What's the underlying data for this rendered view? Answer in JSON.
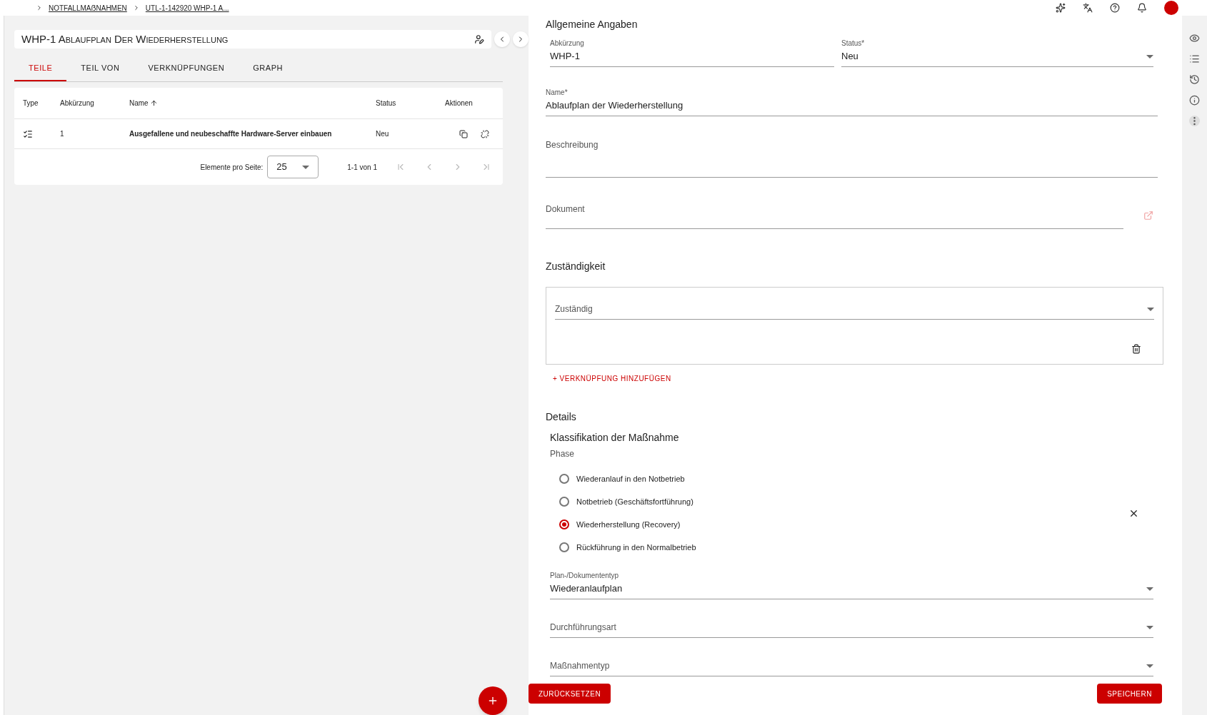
{
  "breadcrumb": [
    "NOTFALLMAẞNAHMEN",
    "UTL-1-142920 WHP-1 A..."
  ],
  "left": {
    "title": "WHP-1 Ablaufplan Der Wiederherstellung",
    "tabs": [
      {
        "label": "TEILE",
        "selected": true
      },
      {
        "label": "TEIL VON",
        "selected": false
      },
      {
        "label": "VERKNÜPFUNGEN",
        "selected": false
      },
      {
        "label": "GRAPH",
        "selected": false
      }
    ],
    "table": {
      "columns": [
        {
          "label": "Type",
          "sorted": false
        },
        {
          "label": "Abkürzung",
          "sorted": false
        },
        {
          "label": "Name",
          "sorted": true
        },
        {
          "label": "Status",
          "sorted": false
        },
        {
          "label": "Aktionen",
          "sorted": false
        }
      ],
      "rows": [
        {
          "abbreviation": "1",
          "name": "Ausgefallene und neubeschaffte Hardware-Server einbauen",
          "status": "Neu"
        }
      ]
    },
    "pagination": {
      "label": "Elemente pro Seite:",
      "page_size": "25",
      "range": "1-1 von 1"
    }
  },
  "form": {
    "general_title": "Allgemeine Angaben",
    "abbreviation": {
      "label": "Abkürzung",
      "value": "WHP-1"
    },
    "status": {
      "label": "Status*",
      "value": "Neu"
    },
    "name": {
      "label": "Name*",
      "value": "Ablaufplan der Wiederherstellung"
    },
    "description": {
      "label": "Beschreibung"
    },
    "document": {
      "label": "Dokument"
    },
    "responsibility_title": "Zuständigkeit",
    "responsible": {
      "label": "Zuständig"
    },
    "add_link": "+ VERKNÜPFUNG HINZUFÜGEN",
    "details_title": "Details",
    "classification_title": "Klassifikation der Maßnahme",
    "phase_label": "Phase",
    "phases": [
      {
        "label": "Wiederanlauf in den Notbetrieb",
        "selected": false
      },
      {
        "label": "Notbetrieb (Geschäftsfortführung)",
        "selected": false
      },
      {
        "label": "Wiederherstellung (Recovery)",
        "selected": true
      },
      {
        "label": "Rückführung in den Normalbetrieb",
        "selected": false
      }
    ],
    "selects": [
      {
        "label": "Plan-/Dokumententyp",
        "value": "Wiederanlaufplan"
      },
      {
        "label": "Durchführungsart"
      },
      {
        "label": "Maßnahmentyp"
      }
    ],
    "reset_button": "ZURÜCKSETZEN",
    "save_button": "SPEICHERN"
  }
}
